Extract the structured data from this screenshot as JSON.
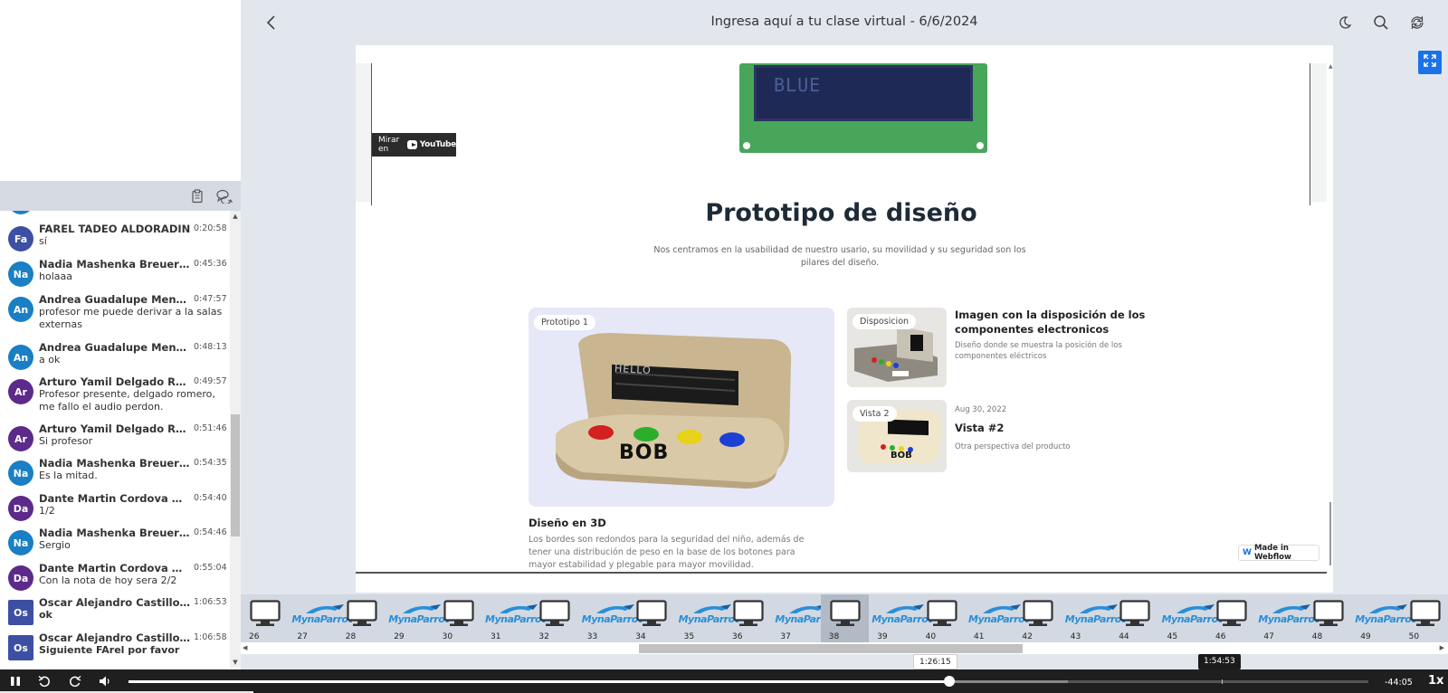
{
  "header": {
    "title": "Ingresa aquí a tu clase virtual - 6/6/2024",
    "back_icon": "chevron-left-icon",
    "icons": [
      "moon-icon",
      "search-icon",
      "refresh-icon"
    ],
    "expand_icon": "expand-icon"
  },
  "chat": {
    "toolbar_icons": [
      "clipboard-icon",
      "chat-bubbles-icon"
    ],
    "partial_text": "sí",
    "messages": [
      {
        "initials": "Fa",
        "color": "#3d4fa3",
        "name": "FAREL TADEO ALDORADIN",
        "time": "0:20:58",
        "text": "sí"
      },
      {
        "initials": "Na",
        "color": "#1a7fc4",
        "name": "Nadia Mashenka Breuer Ba",
        "time": "0:45:36",
        "text": "holaaa"
      },
      {
        "initials": "An",
        "color": "#1a7fc4",
        "name": "Andrea Guadalupe Mena Vi",
        "time": "0:47:57",
        "text": "profesor me puede derivar a la salas externas"
      },
      {
        "initials": "An",
        "color": "#1a7fc4",
        "name": "Andrea Guadalupe Mena Vi",
        "time": "0:48:13",
        "text": "a ok"
      },
      {
        "initials": "Ar",
        "color": "#5b2a8a",
        "name": "Arturo Yamil Delgado Rome",
        "time": "0:49:57",
        "text": "Profesor presente, delgado romero, me fallo el audio perdon."
      },
      {
        "initials": "Ar",
        "color": "#5b2a8a",
        "name": "Arturo Yamil Delgado Rome",
        "time": "0:51:46",
        "text": "Si profesor"
      },
      {
        "initials": "Na",
        "color": "#1a7fc4",
        "name": "Nadia Mashenka Breuer Ba",
        "time": "0:54:35",
        "text": "Es la mitad."
      },
      {
        "initials": "Da",
        "color": "#5b2a8a",
        "name": "Dante Martin Cordova Mor",
        "time": "0:54:40",
        "text": "1/2"
      },
      {
        "initials": "Na",
        "color": "#1a7fc4",
        "name": "Nadia Mashenka Breuer Ba",
        "time": "0:54:46",
        "text": "Sergio"
      },
      {
        "initials": "Da",
        "color": "#5b2a8a",
        "name": "Dante Martin Cordova Mor",
        "time": "0:55:04",
        "text": "Con la nota de hoy  sera 2/2"
      },
      {
        "initials": "Os",
        "color": "#3d4fa3",
        "name": "Oscar Alejandro Castillo Ba",
        "time": "1:06:53",
        "text": "ok",
        "bold": true
      },
      {
        "initials": "Os",
        "color": "#3d4fa3",
        "name": "Oscar Alejandro Castillo Ba",
        "time": "1:06:58",
        "text": "Siguiente FArel por favor",
        "bold": true
      }
    ]
  },
  "slide": {
    "lcd_text": "BLUE",
    "youtube_label": "Mirar en",
    "youtube_brand": "YouTube",
    "title": "Prototipo de diseño",
    "subtitle": "Nos centramos en la usabilidad de nuestro usario, su movilidad y su seguridad son los pilares del diseño.",
    "card_main": {
      "pill": "Prototipo 1",
      "heading": "Diseño en 3D",
      "text": "Los bordes son redondos para la seguridad del niño, además de tener una distribución de peso en la base de los botones para mayor estabilidad y plegable para mayor movilidad.",
      "screen_text": "HELLO",
      "brand_text": "BOB"
    },
    "card_disp": {
      "pill": "Disposicion",
      "heading": "Imagen con la disposición de los componentes electronicos",
      "text": "Diseño donde se muestra la posición de los componentes eléctricos"
    },
    "card_vista": {
      "pill": "Vista 2",
      "date": "Aug 30, 2022",
      "heading": "Vista #2",
      "text": "Otra perspectiva del producto",
      "brand_text": "BOB"
    },
    "webflow_label": "Made in Webflow",
    "webflow_logo": "W"
  },
  "thumbnails": {
    "brand": "MynaParrot",
    "selected": "38",
    "items": [
      "26",
      "27",
      "28",
      "29",
      "30",
      "31",
      "32",
      "33",
      "34",
      "35",
      "36",
      "37",
      "38",
      "39",
      "40",
      "41",
      "42",
      "43",
      "44",
      "45",
      "46",
      "47",
      "48",
      "49",
      "50"
    ]
  },
  "player": {
    "current_tooltip": "1:26:15",
    "hover_tooltip": "1:54:53",
    "remaining": "-44:05",
    "speed": "1x",
    "icons": [
      "pause-icon",
      "rewind-icon",
      "forward-icon",
      "volume-icon"
    ],
    "played_fraction": 0.662,
    "buffered_fraction": 0.758
  }
}
